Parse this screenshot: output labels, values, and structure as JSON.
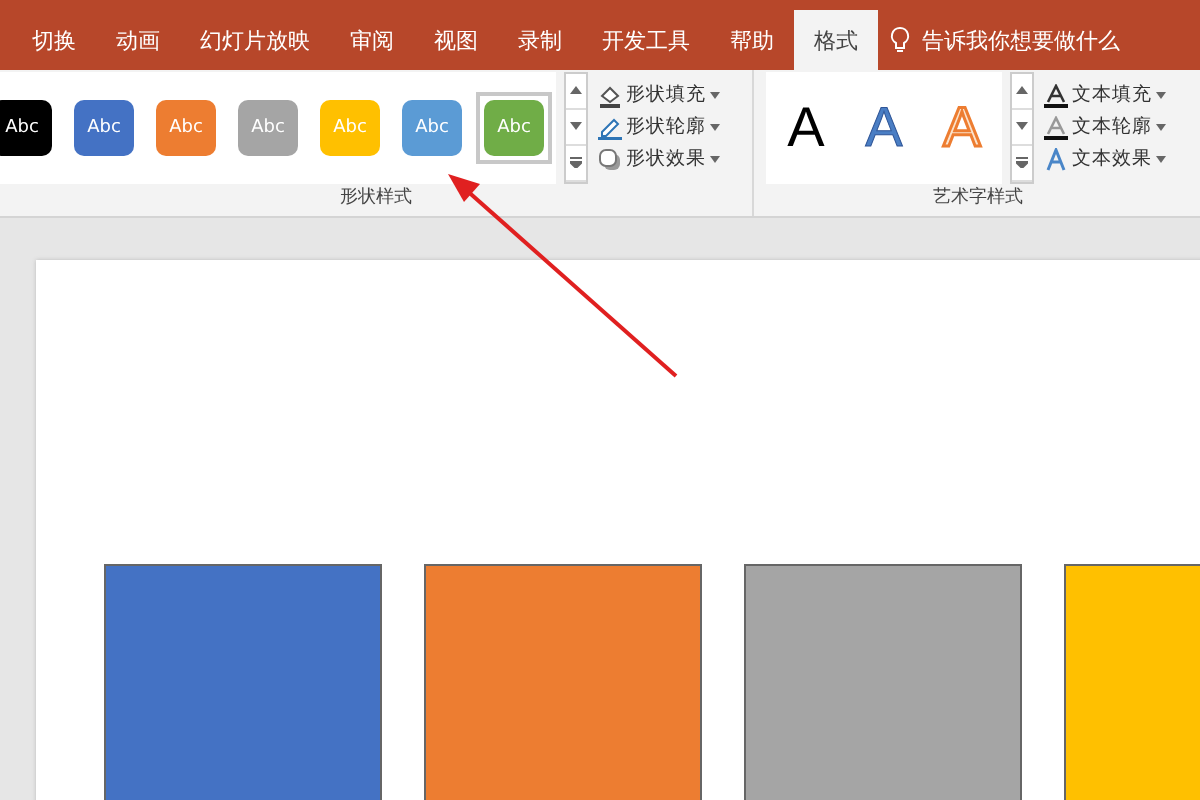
{
  "tabs": [
    {
      "label": "切换",
      "selected": false
    },
    {
      "label": "动画",
      "selected": false
    },
    {
      "label": "幻灯片放映",
      "selected": false
    },
    {
      "label": "审阅",
      "selected": false
    },
    {
      "label": "视图",
      "selected": false
    },
    {
      "label": "录制",
      "selected": false
    },
    {
      "label": "开发工具",
      "selected": false
    },
    {
      "label": "帮助",
      "selected": false
    },
    {
      "label": "格式",
      "selected": true
    }
  ],
  "tell_me": "告诉我你想要做什么",
  "shape_styles": {
    "label": "形状样式",
    "swatches": [
      {
        "text": "Abc",
        "color": "#000000",
        "selected": false
      },
      {
        "text": "Abc",
        "color": "#4472c4",
        "selected": false
      },
      {
        "text": "Abc",
        "color": "#ed7d31",
        "selected": false
      },
      {
        "text": "Abc",
        "color": "#a5a5a5",
        "selected": false
      },
      {
        "text": "Abc",
        "color": "#ffc000",
        "selected": false
      },
      {
        "text": "Abc",
        "color": "#5b9bd5",
        "selected": false
      },
      {
        "text": "Abc",
        "color": "#70ad47",
        "selected": true
      }
    ],
    "menus": [
      {
        "kind": "fill",
        "label": "形状填充"
      },
      {
        "kind": "outline",
        "label": "形状轮廓"
      },
      {
        "kind": "effect",
        "label": "形状效果"
      }
    ]
  },
  "wordart_styles": {
    "label": "艺术字样式",
    "letters": [
      {
        "text": "A",
        "kind": "solid"
      },
      {
        "text": "A",
        "kind": "blue"
      },
      {
        "text": "A",
        "kind": "orange"
      }
    ],
    "menus": [
      {
        "kind": "fill",
        "label": "文本填充"
      },
      {
        "kind": "outline",
        "label": "文本轮廓"
      },
      {
        "kind": "effect",
        "label": "文本效果"
      }
    ]
  },
  "slide_shapes": [
    {
      "color": "#4472c4"
    },
    {
      "color": "#ed7d31"
    },
    {
      "color": "#a5a5a5"
    },
    {
      "color": "#ffc000"
    }
  ]
}
